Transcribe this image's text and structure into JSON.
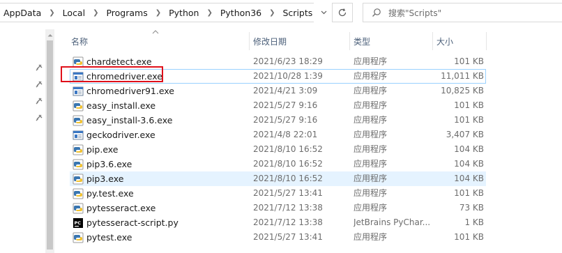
{
  "breadcrumbs": [
    "AppData",
    "Local",
    "Programs",
    "Python",
    "Python36",
    "Scripts"
  ],
  "search": {
    "placeholder": "搜索\"Scripts\""
  },
  "columns": {
    "name": "名称",
    "date": "修改日期",
    "type": "类型",
    "size": "大小"
  },
  "files": [
    {
      "name": "chardetect.exe",
      "date": "2021/6/23 18:29",
      "type": "应用程序",
      "size": "101 KB",
      "icon": "python-exe-icon"
    },
    {
      "name": "chromedriver.exe",
      "date": "2021/10/28 1:39",
      "type": "应用程序",
      "size": "11,011 KB",
      "icon": "app-window-icon"
    },
    {
      "name": "chromedriver91.exe",
      "date": "2021/4/21 3:09",
      "type": "应用程序",
      "size": "10,825 KB",
      "icon": "app-window-icon"
    },
    {
      "name": "easy_install.exe",
      "date": "2021/5/27 9:16",
      "type": "应用程序",
      "size": "101 KB",
      "icon": "python-exe-icon"
    },
    {
      "name": "easy_install-3.6.exe",
      "date": "2021/5/27 9:16",
      "type": "应用程序",
      "size": "101 KB",
      "icon": "python-exe-icon"
    },
    {
      "name": "geckodriver.exe",
      "date": "2021/4/8 22:01",
      "type": "应用程序",
      "size": "3,407 KB",
      "icon": "app-window-icon"
    },
    {
      "name": "pip.exe",
      "date": "2021/8/10 16:52",
      "type": "应用程序",
      "size": "104 KB",
      "icon": "python-exe-icon"
    },
    {
      "name": "pip3.6.exe",
      "date": "2021/8/10 16:52",
      "type": "应用程序",
      "size": "104 KB",
      "icon": "python-exe-icon"
    },
    {
      "name": "pip3.exe",
      "date": "2021/8/10 16:52",
      "type": "应用程序",
      "size": "104 KB",
      "icon": "python-exe-icon"
    },
    {
      "name": "py.test.exe",
      "date": "2021/5/27 13:41",
      "type": "应用程序",
      "size": "101 KB",
      "icon": "python-exe-icon"
    },
    {
      "name": "pytesseract.exe",
      "date": "2021/7/12 13:38",
      "type": "应用程序",
      "size": "73 KB",
      "icon": "python-exe-icon"
    },
    {
      "name": "pytesseract-script.py",
      "date": "2021/7/12 13:38",
      "type": "JetBrains PyChar...",
      "size": "1 KB",
      "icon": "pycharm-file-icon"
    },
    {
      "name": "pytest.exe",
      "date": "2021/5/27 13:41",
      "type": "应用程序",
      "size": "101 KB",
      "icon": "python-exe-icon"
    }
  ],
  "colors": {
    "hover_bg": "#e5f3ff",
    "selected_border": "#99d1ff",
    "annotation_box": "#e0101a"
  }
}
